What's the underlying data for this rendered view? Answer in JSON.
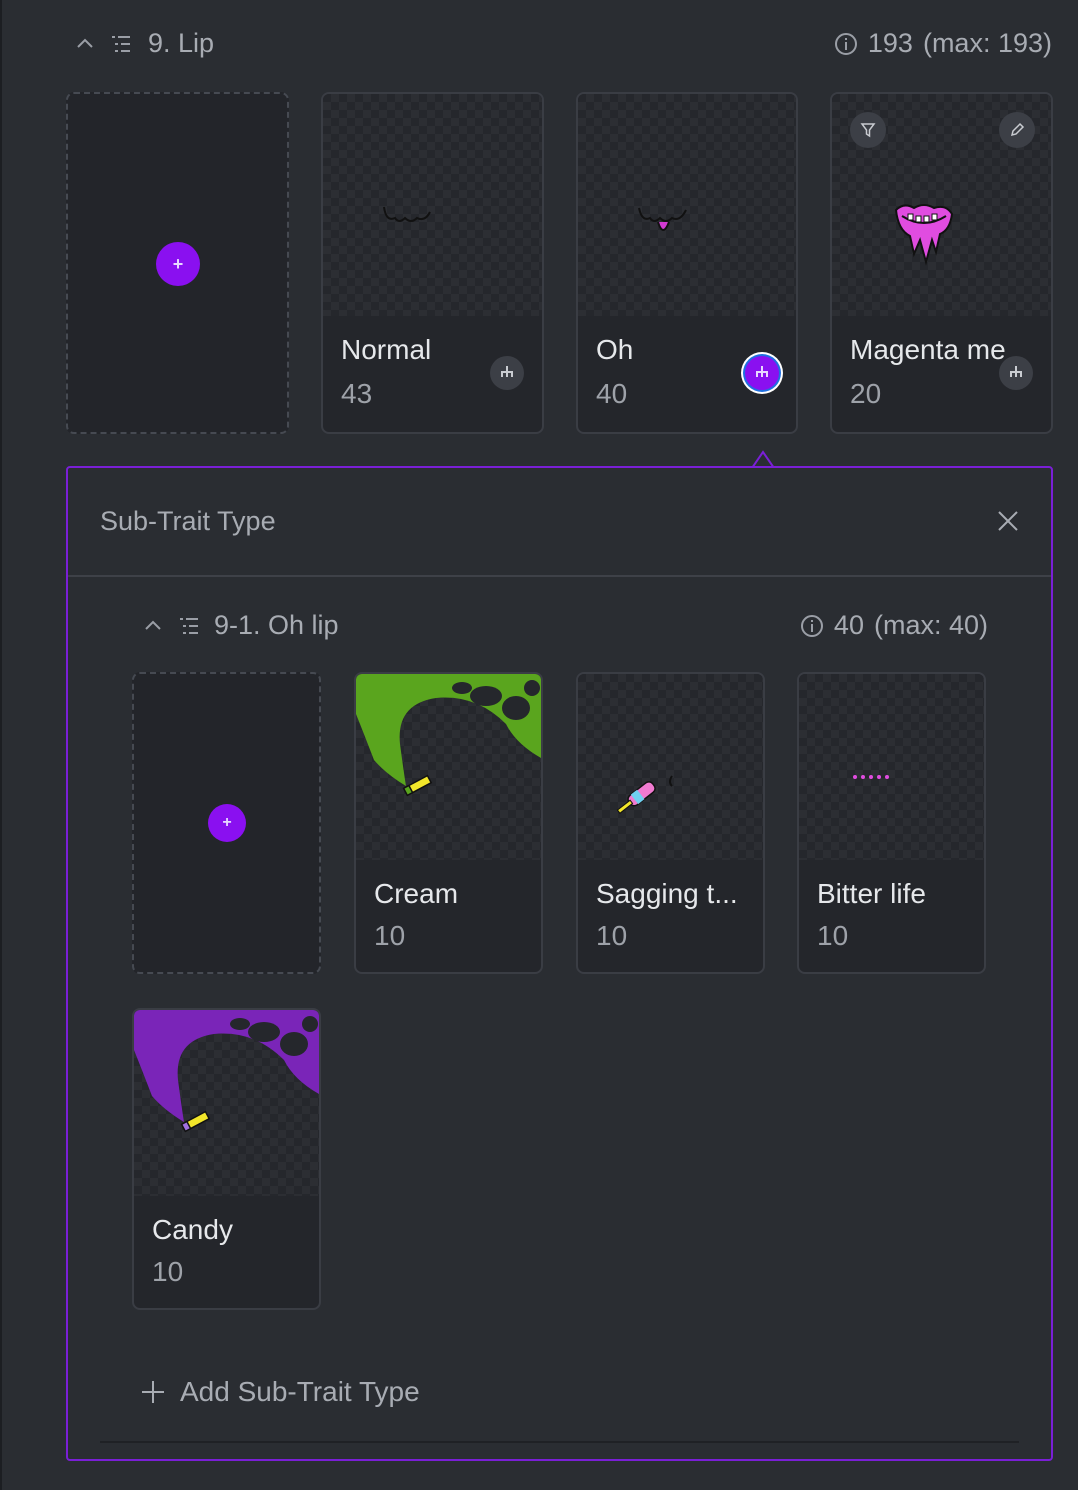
{
  "section": {
    "title": "9. Lip",
    "count": "193",
    "max": "(max: 193)"
  },
  "traits": [
    {
      "name": "Normal",
      "count": "43"
    },
    {
      "name": "Oh",
      "count": "40"
    },
    {
      "name": "Magenta me",
      "count": "20"
    }
  ],
  "panel": {
    "title": "Sub-Trait Type",
    "add_label": "Add Sub-Trait Type"
  },
  "subsection": {
    "title": "9-1. Oh lip",
    "count": "40",
    "max": "(max: 40)"
  },
  "subtraits": [
    {
      "name": "Cream",
      "count": "10"
    },
    {
      "name": "Sagging t...",
      "count": "10"
    },
    {
      "name": "Bitter life",
      "count": "10"
    },
    {
      "name": "Candy",
      "count": "10"
    }
  ],
  "icons": {
    "add": "+",
    "collapse": "chevron-up-icon",
    "list": "list-icon",
    "info": "info-icon",
    "filter": "filter-icon",
    "edit": "pencil-icon",
    "subtrait": "hierarchy-icon",
    "close": "close-icon"
  },
  "colors": {
    "accent": "#8a10f0",
    "panel_border": "#7a1fd6",
    "background": "#2a2d32",
    "cream_slime": "#5aa51e",
    "candy_slime": "#7a25b8",
    "magenta": "#e04ce0"
  }
}
